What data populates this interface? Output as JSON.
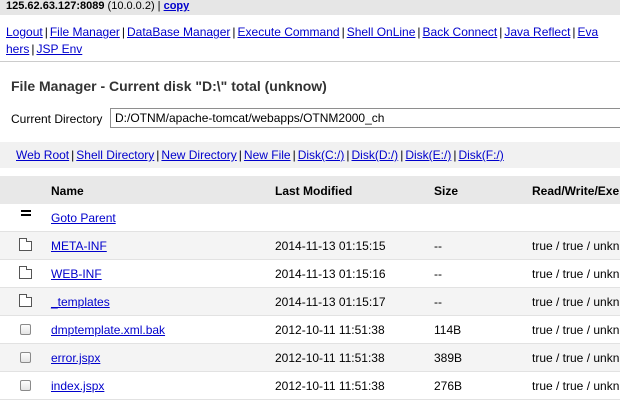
{
  "topbar": {
    "host": "125.62.63.127:8089",
    "local_ip": " (10.0.0.2) | ",
    "copy": "copy"
  },
  "menu": {
    "items": [
      "Logout",
      "File Manager",
      "DataBase Manager",
      "Execute Command",
      "Shell OnLine",
      "Back Connect",
      "Java Reflect",
      "Eva"
    ],
    "row2": [
      "hers",
      "JSP Env"
    ]
  },
  "title": "File Manager - Current disk \"D:\\\" total (unknow)",
  "current_directory": {
    "label": "Current Directory",
    "value": "D:/OTNM/apache-tomcat/webapps/OTNM2000_ch"
  },
  "quick_links": [
    "Web Root",
    "Shell Directory",
    "New Directory",
    "New File",
    "Disk(C:/)",
    "Disk(D:/)",
    "Disk(E:/)",
    "Disk(F:/)"
  ],
  "table": {
    "headers": {
      "name": "Name",
      "modified": "Last Modified",
      "size": "Size",
      "rw": "Read/Write/Exe"
    },
    "goto_parent": "Goto Parent",
    "rows": [
      {
        "type": "folder",
        "name": "META-INF",
        "modified": "2014-11-13 01:15:15",
        "size": "--",
        "rw": "true / true / unkn"
      },
      {
        "type": "folder",
        "name": "WEB-INF",
        "modified": "2014-11-13 01:15:16",
        "size": "--",
        "rw": "true / true / unkn"
      },
      {
        "type": "folder",
        "name": "_templates",
        "modified": "2014-11-13 01:15:17",
        "size": "--",
        "rw": "true / true / unkn"
      },
      {
        "type": "file",
        "name": "dmptemplate.xml.bak",
        "modified": "2012-10-11 11:51:38",
        "size": "114B",
        "rw": "true / true / unkn"
      },
      {
        "type": "file",
        "name": "error.jspx",
        "modified": "2012-10-11 11:51:38",
        "size": "389B",
        "rw": "true / true / unkn"
      },
      {
        "type": "file",
        "name": "index.jspx",
        "modified": "2012-10-11 11:51:38",
        "size": "276B",
        "rw": "true / true / unkn"
      }
    ]
  }
}
